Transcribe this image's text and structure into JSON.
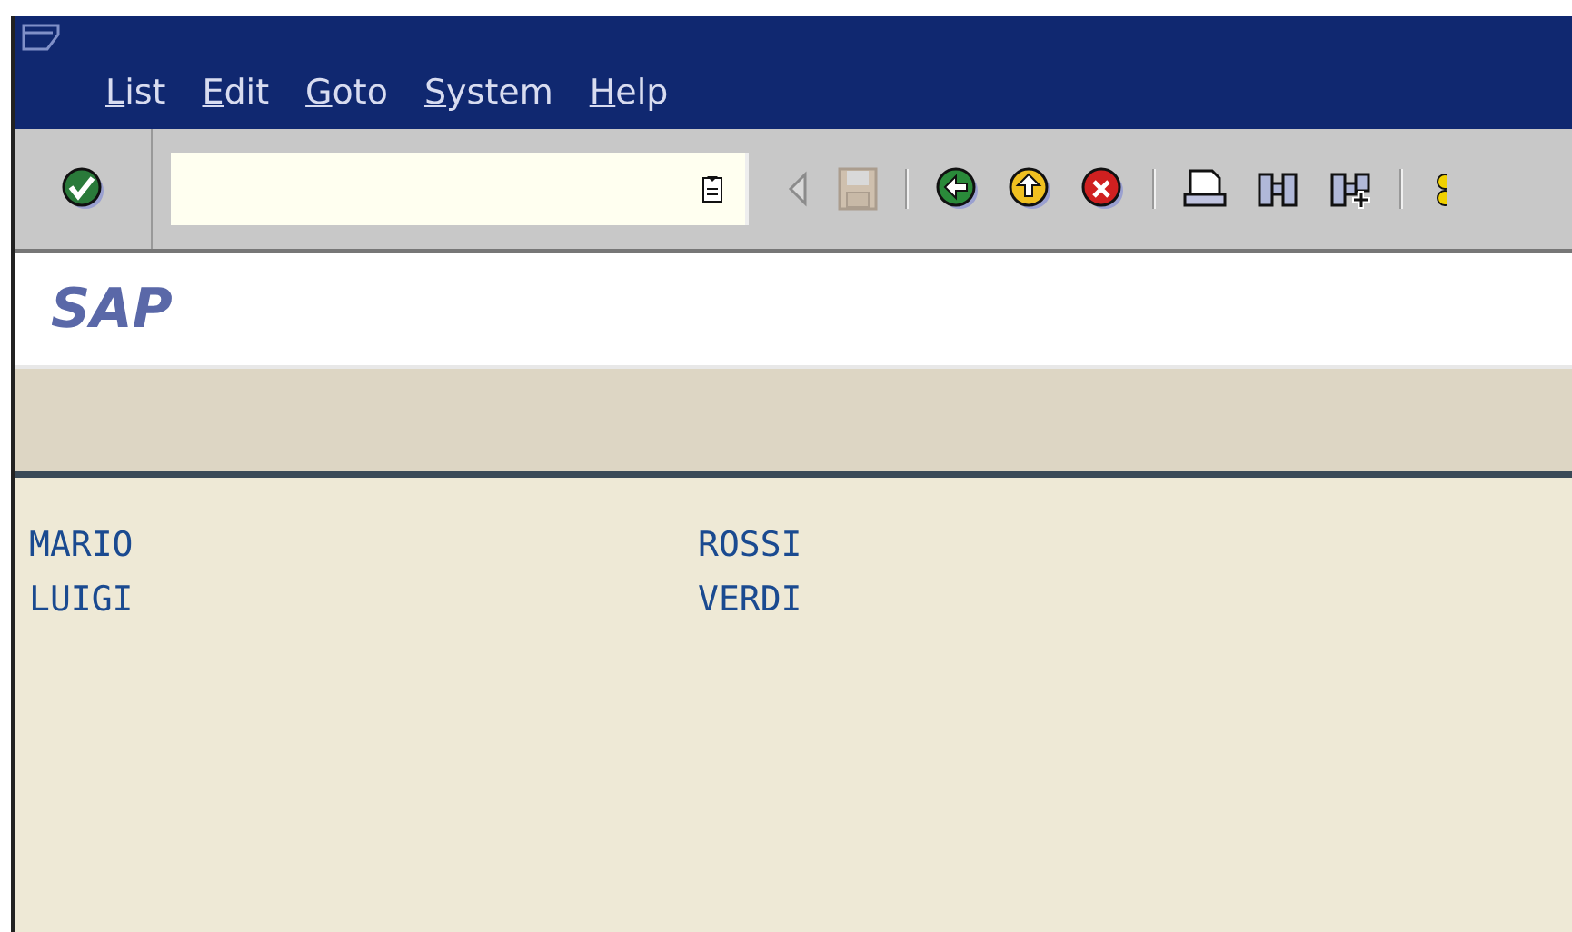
{
  "menu": [
    {
      "label": "List"
    },
    {
      "label": "Edit"
    },
    {
      "label": "Goto"
    },
    {
      "label": "System"
    },
    {
      "label": "Help"
    }
  ],
  "toolbar": [
    {
      "kind": "back-triangle",
      "disabled": true
    },
    {
      "kind": "save",
      "disabled": true
    },
    {
      "kind": "sep"
    },
    {
      "kind": "back",
      "disabled": false
    },
    {
      "kind": "up",
      "disabled": false
    },
    {
      "kind": "cancel",
      "disabled": false
    },
    {
      "kind": "sep"
    },
    {
      "kind": "print",
      "disabled": false
    },
    {
      "kind": "find",
      "disabled": false
    },
    {
      "kind": "find-next",
      "disabled": false
    },
    {
      "kind": "sep"
    },
    {
      "kind": "more",
      "disabled": false
    }
  ],
  "title": "SAP",
  "rows": [
    {
      "first": "MARIO",
      "last": "ROSSI"
    },
    {
      "first": "LUIGI",
      "last": "VERDI"
    }
  ]
}
